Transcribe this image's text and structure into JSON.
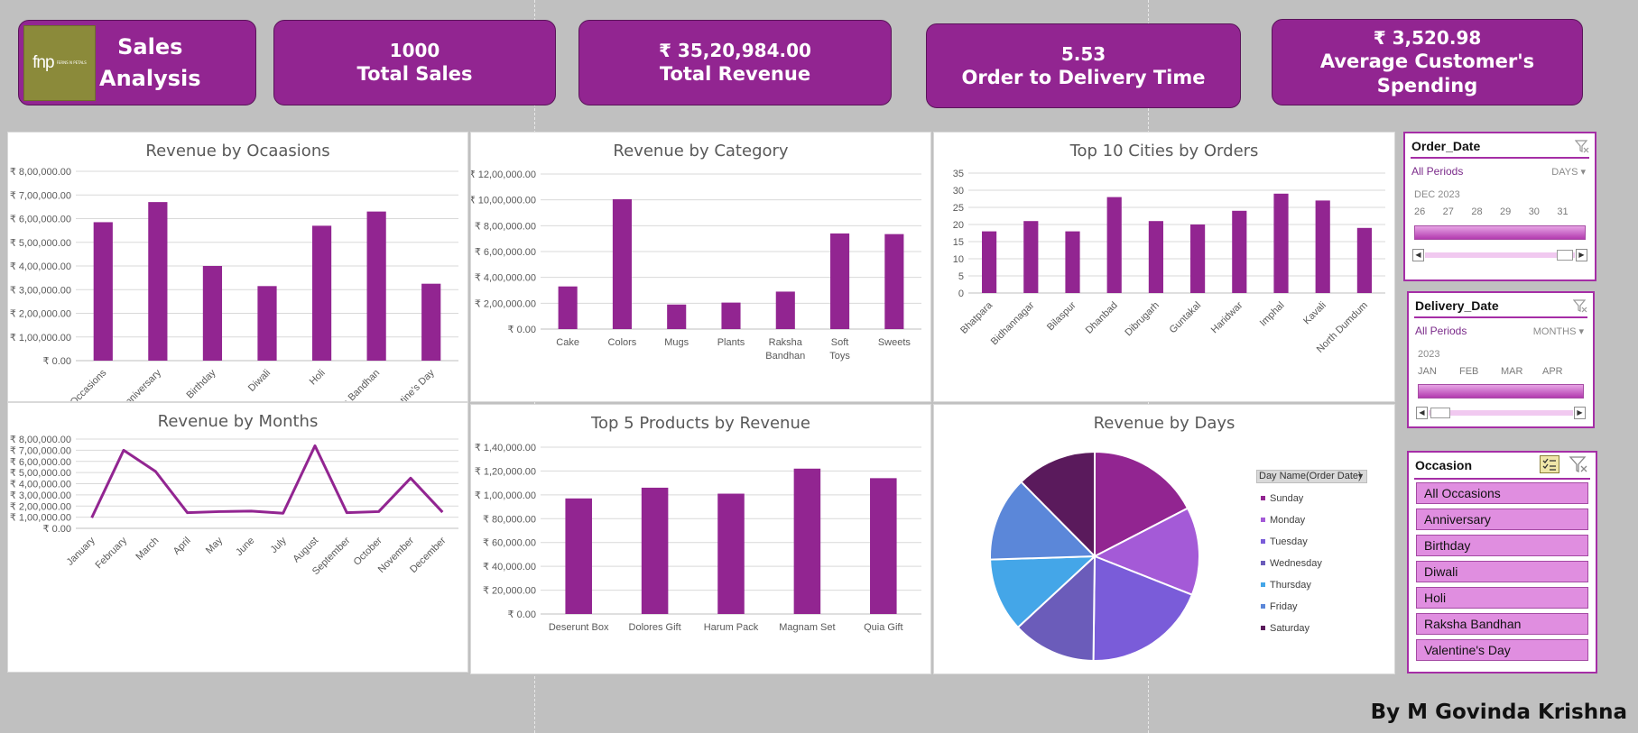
{
  "header": {
    "logo": {
      "brand": "fnp",
      "tagline": "FERNS N PETALS"
    },
    "title": "Sales\nAnalysis",
    "title_line1": "Sales",
    "title_line2": "Analysis",
    "kpis": [
      {
        "value": "1000",
        "label": "Total Sales"
      },
      {
        "value": "₹ 35,20,984.00",
        "label": "Total Revenue"
      },
      {
        "value": "5.53",
        "label": "Order to Delivery Time"
      },
      {
        "value": "₹ 3,520.98",
        "label": "Average Customer's Spending"
      }
    ]
  },
  "colors": {
    "bar": "#922591",
    "accent": "#922591",
    "background": "#c0c0c0"
  },
  "chart_data": [
    {
      "type": "bar",
      "title": "Revenue by Ocaasions",
      "categories": [
        "All Occasions",
        "Anniversary",
        "Birthday",
        "Diwali",
        "Holi",
        "Raksha Bandhan",
        "Valentine's Day"
      ],
      "values": [
        585000,
        670000,
        400000,
        315000,
        570000,
        630000,
        325000
      ],
      "ylim": [
        0,
        800000
      ],
      "yticks": [
        "₹ 0.00",
        "₹ 1,00,000.00",
        "₹ 2,00,000.00",
        "₹ 3,00,000.00",
        "₹ 4,00,000.00",
        "₹ 5,00,000.00",
        "₹ 6,00,000.00",
        "₹ 7,00,000.00",
        "₹ 8,00,000.00"
      ]
    },
    {
      "type": "bar",
      "title": "Revenue by Category",
      "categories": [
        "Cake",
        "Colors",
        "Mugs",
        "Plants",
        "Raksha Bandhan",
        "Soft Toys",
        "Sweets"
      ],
      "values": [
        330000,
        1005000,
        190000,
        205000,
        290000,
        740000,
        735000
      ],
      "ylim": [
        0,
        1200000
      ],
      "yticks": [
        "₹ 0.00",
        "₹ 2,00,000.00",
        "₹ 4,00,000.00",
        "₹ 6,00,000.00",
        "₹ 8,00,000.00",
        "₹ 10,00,000.00",
        "₹ 12,00,000.00"
      ]
    },
    {
      "type": "bar",
      "title": "Top 10 Cities by Orders",
      "categories": [
        "Bhatpara",
        "Bidhannagar",
        "Bilaspur",
        "Dhanbad",
        "Dibrugarh",
        "Guntakal",
        "Haridwar",
        "Imphal",
        "Kavali",
        "North Dumdum"
      ],
      "values": [
        18,
        21,
        18,
        28,
        21,
        20,
        24,
        29,
        27,
        19
      ],
      "ylim": [
        0,
        35
      ],
      "yticks": [
        "0",
        "5",
        "10",
        "15",
        "20",
        "25",
        "30",
        "35"
      ]
    },
    {
      "type": "line",
      "title": "Revenue by Months",
      "categories": [
        "January",
        "February",
        "March",
        "April",
        "May",
        "June",
        "July",
        "August",
        "September",
        "October",
        "November",
        "December"
      ],
      "values": [
        95000,
        700000,
        510000,
        140000,
        150000,
        155000,
        135000,
        740000,
        140000,
        150000,
        450000,
        145000
      ],
      "ylim": [
        0,
        800000
      ],
      "yticks": [
        "₹ 0.00",
        "₹ 1,00,000.00",
        "₹ 2,00,000.00",
        "₹ 3,00,000.00",
        "₹ 4,00,000.00",
        "₹ 5,00,000.00",
        "₹ 6,00,000.00",
        "₹ 7,00,000.00",
        "₹ 8,00,000.00"
      ]
    },
    {
      "type": "bar",
      "title": "Top 5 Products by Revenue",
      "categories": [
        "Deserunt Box",
        "Dolores Gift",
        "Harum Pack",
        "Magnam Set",
        "Quia Gift"
      ],
      "values": [
        97000,
        106000,
        101000,
        122000,
        114000
      ],
      "ylim": [
        0,
        140000
      ],
      "yticks": [
        "₹ 0.00",
        "₹ 20,000.00",
        "₹ 40,000.00",
        "₹ 60,000.00",
        "₹ 80,000.00",
        "₹ 1,00,000.00",
        "₹ 1,20,000.00",
        "₹ 1,40,000.00"
      ]
    },
    {
      "type": "pie",
      "title": "Revenue by Days",
      "legend_title": "Day Name(Order Date)",
      "legend_position": "right",
      "categories": [
        "Sunday",
        "Monday",
        "Tuesday",
        "Wednesday",
        "Thursday",
        "Friday",
        "Saturday"
      ],
      "values": [
        17.4,
        13.6,
        19.2,
        12.9,
        11.4,
        13.1,
        12.4
      ],
      "colors": [
        "#922591",
        "#a45ad7",
        "#7a5cd9",
        "#6b5cba",
        "#44a6e8",
        "#5b87d9",
        "#5a1a5c"
      ]
    }
  ],
  "slicers": {
    "order_date": {
      "title": "Order_Date",
      "period": "All Periods",
      "unit": "DAYS",
      "year": "DEC 2023",
      "labels": [
        "26",
        "27",
        "28",
        "29",
        "30",
        "31"
      ]
    },
    "delivery_date": {
      "title": "Delivery_Date",
      "period": "All Periods",
      "unit": "MONTHS",
      "year": "2023",
      "labels": [
        "JAN",
        "FEB",
        "MAR",
        "APR"
      ]
    },
    "occasion": {
      "title": "Occasion",
      "items": [
        "All Occasions",
        "Anniversary",
        "Birthday",
        "Diwali",
        "Holi",
        "Raksha Bandhan",
        "Valentine's Day"
      ]
    }
  },
  "author": "By M Govinda Krishna"
}
